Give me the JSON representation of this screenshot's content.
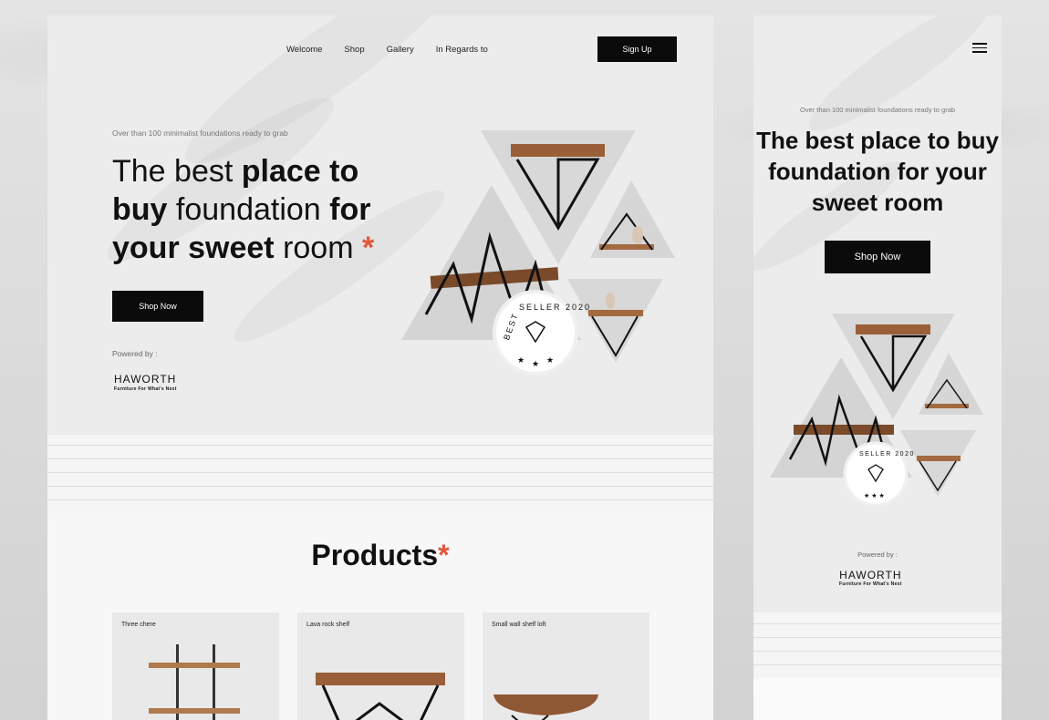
{
  "desktop": {
    "nav": [
      "Welcome",
      "Shop",
      "Gallery",
      "In Regards to"
    ],
    "signup_label": "Sign Up",
    "tagline": "Over than 100 minimalist foundations ready to grab",
    "headline": {
      "w1": "The best ",
      "b1": "place to buy",
      "w2": " foundation ",
      "b2": "for your sweet",
      "w3": " room ",
      "mark": "*"
    },
    "shop_now": "Shop Now",
    "powered_by": "Powered by :",
    "brand": "HAWORTH",
    "brand_sub": "Furniture For What's Next",
    "badge": {
      "top": "SELLER 2020",
      "left": "BEST"
    },
    "products_title": "Products",
    "products_mark": "*",
    "products": [
      {
        "name": "Three chere"
      },
      {
        "name": "Lava rock shelf"
      },
      {
        "name": "Small wall shelf loft"
      }
    ]
  },
  "mobile": {
    "tagline": "Over than 100 minimalist foundations ready to grab",
    "headline": {
      "w1": "The best ",
      "b1": "place to buy",
      "w2": " foundation ",
      "b2": "for your sweet",
      "w3": " room"
    },
    "shop_now": "Shop Now",
    "powered_by": "Powered by :",
    "brand": "HAWORTH",
    "brand_sub": "Furniture For What's Next"
  },
  "colors": {
    "accent": "#e2553b",
    "dark": "#0b0b0b",
    "wood": "#a0653e"
  }
}
